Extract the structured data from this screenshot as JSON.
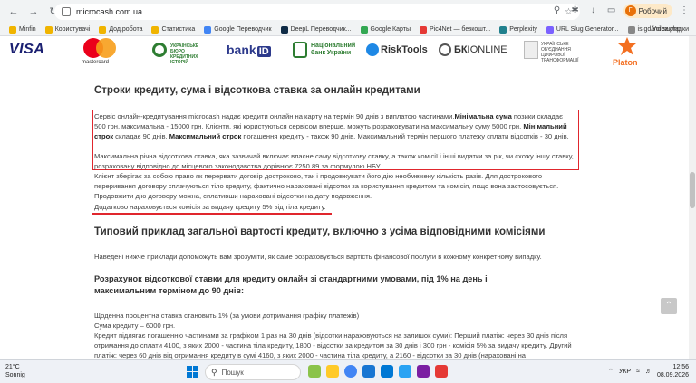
{
  "browser": {
    "url": "microcash.com.ua",
    "profile": {
      "initial": "Г",
      "label": "Робочий"
    }
  },
  "bookmarks": [
    {
      "label": "Minfin",
      "color": "#f0b400"
    },
    {
      "label": "Користувачі",
      "color": "#f0b400"
    },
    {
      "label": "Дод.робота",
      "color": "#f0b400"
    },
    {
      "label": "Статистика",
      "color": "#f0b400"
    },
    {
      "label": "Google Переводчик",
      "color": "#4285f4"
    },
    {
      "label": "DeepL Переводчик...",
      "color": "#0f2b46"
    },
    {
      "label": "Google Карты",
      "color": "#34a853"
    },
    {
      "label": "Pic4Net — безкошт...",
      "color": "#e53935"
    },
    {
      "label": "Perplexity",
      "color": "#20808d"
    },
    {
      "label": "URL Slug Generator...",
      "color": "#7b61ff"
    },
    {
      "label": "is.gd/index.php",
      "color": "#888888"
    }
  ],
  "bookmarks_all": "Усі закладки",
  "logos": {
    "visa": "VISA",
    "mastercard": "mastercard",
    "ubki": "УКРАЇНСЬКЕ БЮРО КРЕДИТНИХ ІСТОРІЙ",
    "bankid_prefix": "bank",
    "bankid_suffix": "ID",
    "nbu": "Національний банк України",
    "risktools": "RiskTools",
    "bki_bold": "БКІ",
    "bki_rest": "ONLINE",
    "ukr": "УКРАЇНСЬКЕ ОБ'ЄДНАННЯ ЦИФРОВОЇ ТРАНСФОРМАЦІЇ",
    "platon": "Platon"
  },
  "content": {
    "heading1": "Строки кредиту, сума і відсоткова ставка за онлайн кредитами",
    "p1_a": "Сервіс онлайн-кредитування microcash надає кредити онлайн на карту на термін 90 днів з виплатою частинами.",
    "p1_b": "Мінімальна сума",
    "p1_c": " позики складає 500 грн, максимальна - 15000 грн. Клієнти, які користуються сервісом вперше, можуть розраховувати на максимальну суму 5000 грн. ",
    "p1_d": "Мінімальний строк",
    "p1_e": " складає 90 днів. ",
    "p1_f": "Максимальний строк",
    "p1_g": " погашення кредиту - також 90 днів. Максимальний термін першого платежу сплати відсотків - 30 днів.",
    "p2": "Максимальна річна відсоткова ставка, яка зазвичай включає власне саму відсоткову ставку, а також комісії і інші видатки за рік, чи схожу іншу ставку, розраховану відповідно до місцевого законодавства дорівнює 7250.89 за формулою НБУ.",
    "p3": "Клієнт зберігає за собою право як перервати договір достроково, так і продовжувати його дію необмежену кількість разів. Для дострокового переривання договору сплачуються тіло кредиту, фактично нараховані відсотки за користування кредитом та комісія, якщо вона застосовується. Продовжити дію договору можна, сплативши нараховані відсотки на дату подовження.",
    "p4": "Додатково нараховується комісія за видачу кредиту 5% від тіла кредиту.",
    "heading2": "Типовий приклад загальної вартості кредиту, включно з усіма відповідними комісіями",
    "p5": "Наведені нижче приклади допоможуть вам зрозуміти, як саме розраховується вартість фінансової послуги в кожному конкретному випадку.",
    "heading3": "Розрахунок відсоткової ставки для кредиту онлайн зі стандартними умовами, під 1% на день і максимальним терміном до 90 днів:",
    "p6": "Щоденна процентна ставка становить 1% (за умови дотримання графіку платежів)",
    "p7": "Сума кредиту – 6000 грн.",
    "p8": "Кредит підлягає погашенню частинами за графіком 1 раз на 30 днів (відсотки нараховуються на залишок суми): Перший платіж: через 30 днів після отримання до сплати 4100, з яких 2000 - частина тіла кредиту, 1800 - відсотки за кредитом за 30 днів і 300 грн - комісія 5% за видачу кредиту. Другий платіж: через 60 днів від отримання кредиту в сумі 4160, з яких 2000 - частина тіла кредиту, а 2160 - відсотки за 30 днів (нараховані на"
  },
  "taskbar": {
    "temp": "21°C",
    "weather": "Sonnig",
    "search": "Пошук",
    "lang": "УКР",
    "time": "12:56",
    "date": "08.09.2026"
  }
}
